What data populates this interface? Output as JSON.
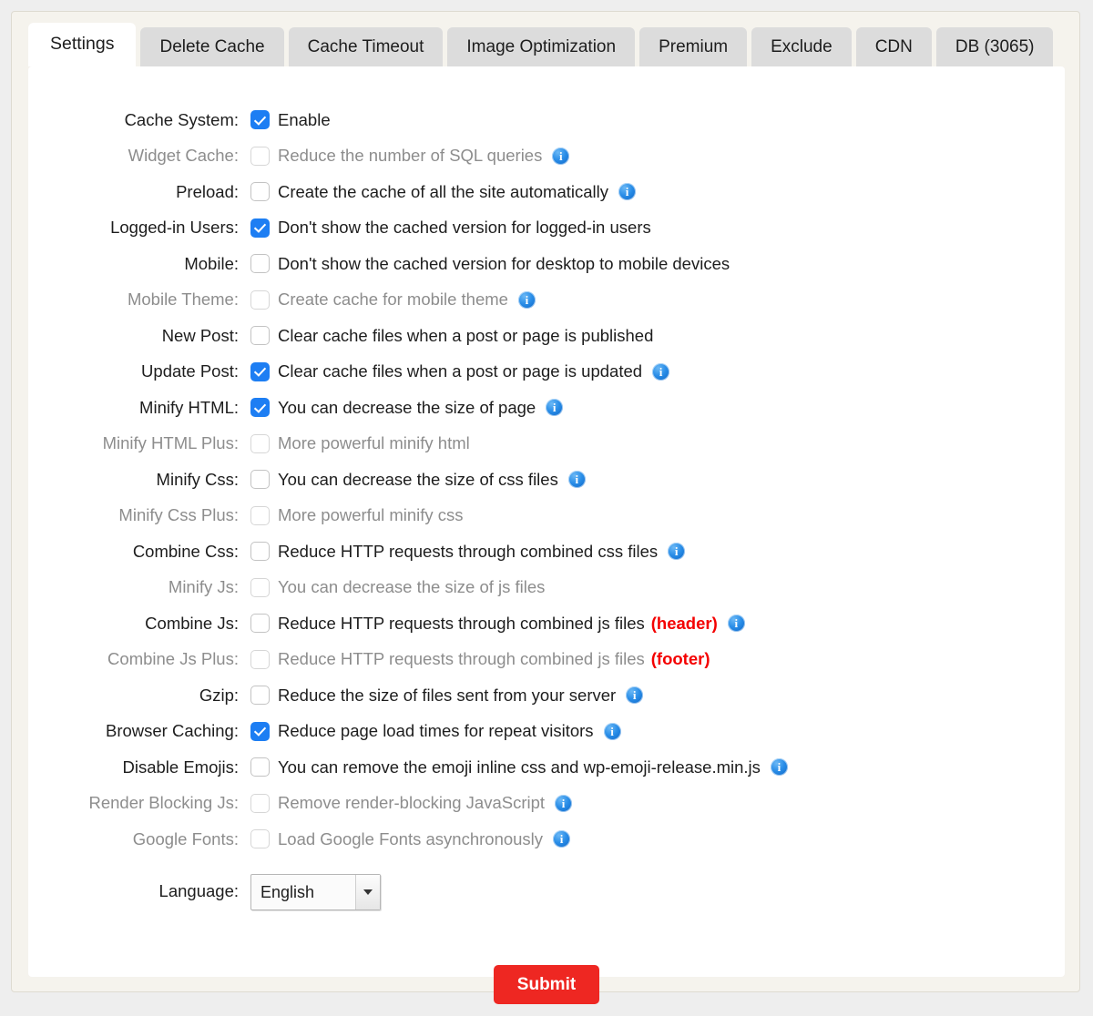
{
  "tabs": [
    {
      "label": "Settings",
      "active": true
    },
    {
      "label": "Delete Cache",
      "active": false
    },
    {
      "label": "Cache Timeout",
      "active": false
    },
    {
      "label": "Image Optimization",
      "active": false
    },
    {
      "label": "Premium",
      "active": false
    },
    {
      "label": "Exclude",
      "active": false
    },
    {
      "label": "CDN",
      "active": false
    },
    {
      "label": "DB (3065)",
      "active": false
    }
  ],
  "colors": {
    "page_background": "#eeeeee",
    "frame_background": "#f5f3ed",
    "panel_background": "#ffffff",
    "tab_inactive": "#dcdcdc",
    "tab_active": "#ffffff",
    "checkbox_checked": "#1d7ef3",
    "info_icon": "#2a8ee8",
    "suffix_red": "#f40000",
    "submit_red": "#ee2722",
    "disabled_text": "#8d8d8d"
  },
  "settings": [
    {
      "label": "Cache System:",
      "text": "Enable",
      "checked": true,
      "disabled": false,
      "info": false,
      "suffix": ""
    },
    {
      "label": "Widget Cache:",
      "text": "Reduce the number of SQL queries",
      "checked": false,
      "disabled": true,
      "info": true,
      "suffix": ""
    },
    {
      "label": "Preload:",
      "text": "Create the cache of all the site automatically",
      "checked": false,
      "disabled": false,
      "info": true,
      "suffix": ""
    },
    {
      "label": "Logged-in Users:",
      "text": "Don't show the cached version for logged-in users",
      "checked": true,
      "disabled": false,
      "info": false,
      "suffix": ""
    },
    {
      "label": "Mobile:",
      "text": "Don't show the cached version for desktop to mobile devices",
      "checked": false,
      "disabled": false,
      "info": false,
      "suffix": ""
    },
    {
      "label": "Mobile Theme:",
      "text": "Create cache for mobile theme",
      "checked": false,
      "disabled": true,
      "info": true,
      "suffix": ""
    },
    {
      "label": "New Post:",
      "text": "Clear cache files when a post or page is published",
      "checked": false,
      "disabled": false,
      "info": false,
      "suffix": ""
    },
    {
      "label": "Update Post:",
      "text": "Clear cache files when a post or page is updated",
      "checked": true,
      "disabled": false,
      "info": true,
      "suffix": ""
    },
    {
      "label": "Minify HTML:",
      "text": "You can decrease the size of page",
      "checked": true,
      "disabled": false,
      "info": true,
      "suffix": ""
    },
    {
      "label": "Minify HTML Plus:",
      "text": "More powerful minify html",
      "checked": false,
      "disabled": true,
      "info": false,
      "suffix": ""
    },
    {
      "label": "Minify Css:",
      "text": "You can decrease the size of css files",
      "checked": false,
      "disabled": false,
      "info": true,
      "suffix": ""
    },
    {
      "label": "Minify Css Plus:",
      "text": "More powerful minify css",
      "checked": false,
      "disabled": true,
      "info": false,
      "suffix": ""
    },
    {
      "label": "Combine Css:",
      "text": "Reduce HTTP requests through combined css files",
      "checked": false,
      "disabled": false,
      "info": true,
      "suffix": ""
    },
    {
      "label": "Minify Js:",
      "text": "You can decrease the size of js files",
      "checked": false,
      "disabled": true,
      "info": false,
      "suffix": ""
    },
    {
      "label": "Combine Js:",
      "text": "Reduce HTTP requests through combined js files",
      "checked": false,
      "disabled": false,
      "info": true,
      "suffix": "(header)"
    },
    {
      "label": "Combine Js Plus:",
      "text": "Reduce HTTP requests through combined js files",
      "checked": false,
      "disabled": true,
      "info": false,
      "suffix": "(footer)"
    },
    {
      "label": "Gzip:",
      "text": "Reduce the size of files sent from your server",
      "checked": false,
      "disabled": false,
      "info": true,
      "suffix": ""
    },
    {
      "label": "Browser Caching:",
      "text": "Reduce page load times for repeat visitors",
      "checked": true,
      "disabled": false,
      "info": true,
      "suffix": ""
    },
    {
      "label": "Disable Emojis:",
      "text": "You can remove the emoji inline css and wp-emoji-release.min.js",
      "checked": false,
      "disabled": false,
      "info": true,
      "suffix": ""
    },
    {
      "label": "Render Blocking Js:",
      "text": "Remove render-blocking JavaScript",
      "checked": false,
      "disabled": true,
      "info": true,
      "suffix": ""
    },
    {
      "label": "Google Fonts:",
      "text": "Load Google Fonts asynchronously",
      "checked": false,
      "disabled": true,
      "info": true,
      "suffix": ""
    }
  ],
  "language": {
    "label": "Language:",
    "selected": "English",
    "options": [
      "English"
    ]
  },
  "submit": {
    "label": "Submit"
  }
}
